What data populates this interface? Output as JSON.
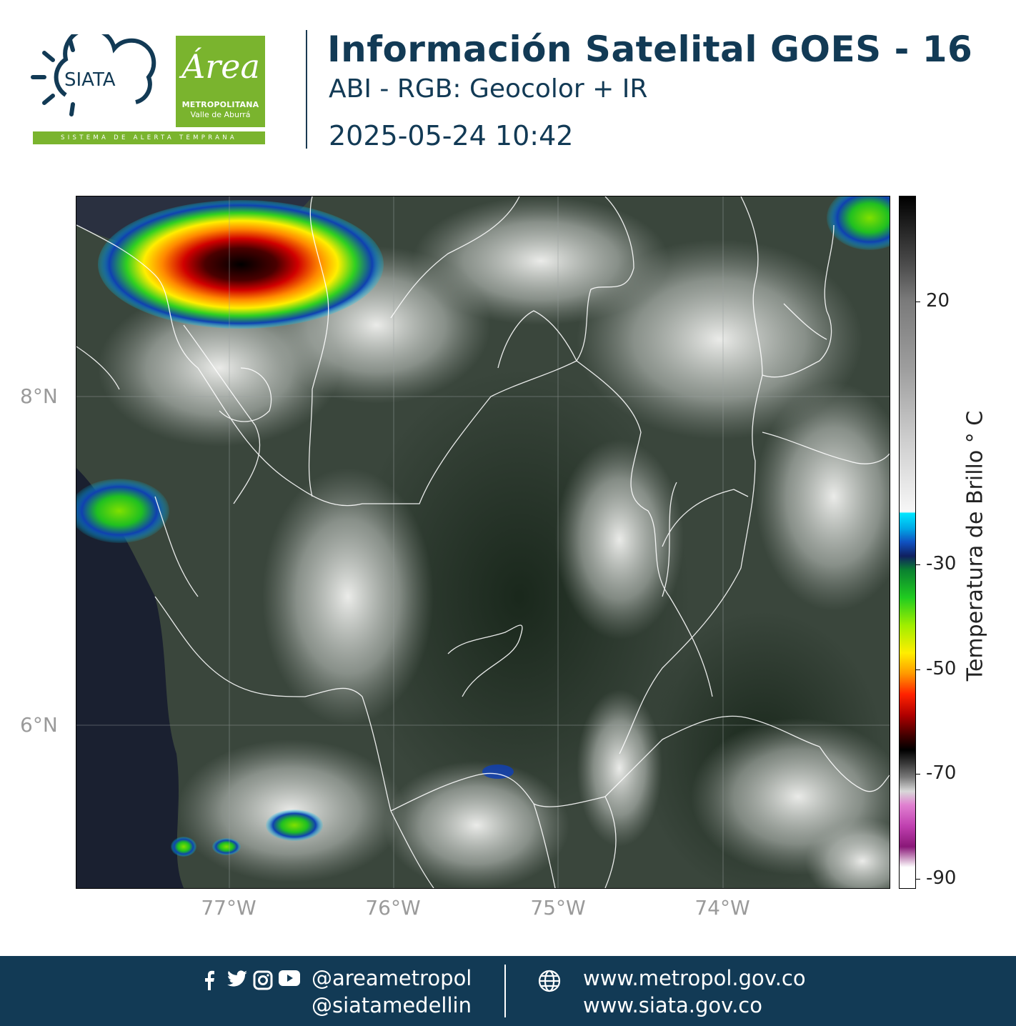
{
  "header": {
    "title": "Información Satelital GOES - 16",
    "subtitle": "ABI - RGB: Geocolor + IR",
    "timestamp": "2025-05-24 10:42"
  },
  "logos": {
    "siata": "SIATA",
    "siata_tagline": "SISTEMA DE ALERTA TEMPRANA",
    "area_word": "Área",
    "area_line1": "METROPOLITANA",
    "area_line2": "Valle de Aburrá"
  },
  "map": {
    "lat_labels": [
      "8°N",
      "6°N"
    ],
    "lon_labels": [
      "77°W",
      "76°W",
      "75°W",
      "74°W"
    ]
  },
  "colorbar": {
    "title": "Temperatura de Brillo ° C",
    "ticks": [
      "20",
      "-30",
      "-50",
      "-70",
      "-90"
    ]
  },
  "footer": {
    "social_icons": [
      "facebook-icon",
      "twitter-icon",
      "instagram-icon",
      "youtube-icon"
    ],
    "handles": [
      "@areametropol",
      "@siatamedellin"
    ],
    "sites": [
      "www.metropol.gov.co",
      "www.siata.gov.co"
    ]
  },
  "colors": {
    "navy": "#123a55",
    "green": "#7ab42e"
  }
}
